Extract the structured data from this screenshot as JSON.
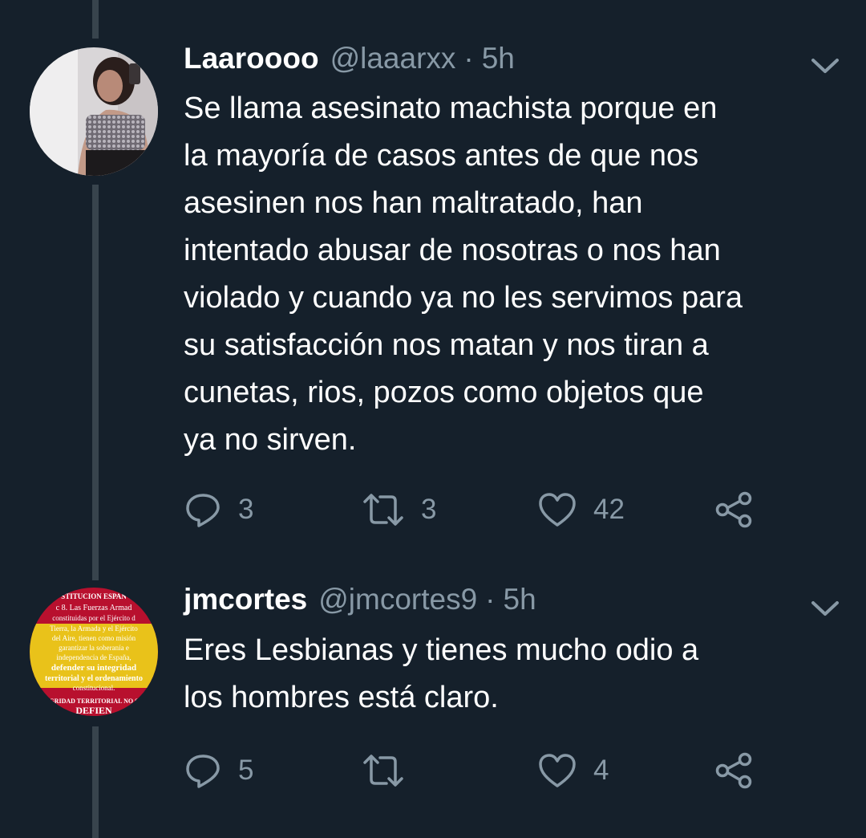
{
  "tweets": [
    {
      "name": "Laaroooo",
      "handle": "@laaarxx",
      "separator": "·",
      "time": "5h",
      "text": "Se llama asesinato machista porque en\nla mayoría de casos antes de que nos\nasesinen nos han maltratado, han\nintentado abusar de nosotras o nos han\nviolado y cuando ya no les servimos para\nsu satisfacción nos matan y nos tiran a\ncunetas, rios, pozos como objetos que\nya no sirven.",
      "replies": "3",
      "retweets": "3",
      "likes": "42"
    },
    {
      "name": "jmcortes",
      "handle": "@jmcortes9",
      "separator": "·",
      "time": "5h",
      "text": "Eres Lesbianas y tienes mucho odio a\nlos hombres está claro.",
      "replies": "5",
      "retweets": "",
      "likes": "4",
      "avatar_text": {
        "line1": "STITUCION ESPAÑ",
        "line2": "c 8. Las Fuerzas Armad",
        "line3": "constituidas por el Ejército d",
        "line4": "Tierra, la Armada y el Ejército",
        "line5": "del Aire, tienen como misión",
        "line6": "garantizar la soberanía e",
        "line7": "independencia de España,",
        "line8": "defender su integridad",
        "line9": "territorial y el ordenamiento",
        "line10": "constitucional.",
        "line11": "GRIDAD TERRITORIAL NO S",
        "line12": "DEFIEN"
      }
    }
  ],
  "icons": {
    "reply": "reply-icon",
    "retweet": "retweet-icon",
    "like": "heart-icon",
    "share": "share-icon",
    "more": "chevron-down-icon"
  },
  "colors": {
    "background": "#15202b",
    "thread_line": "#38444d",
    "secondary_text": "#8899a6",
    "primary_text": "#ffffff"
  }
}
